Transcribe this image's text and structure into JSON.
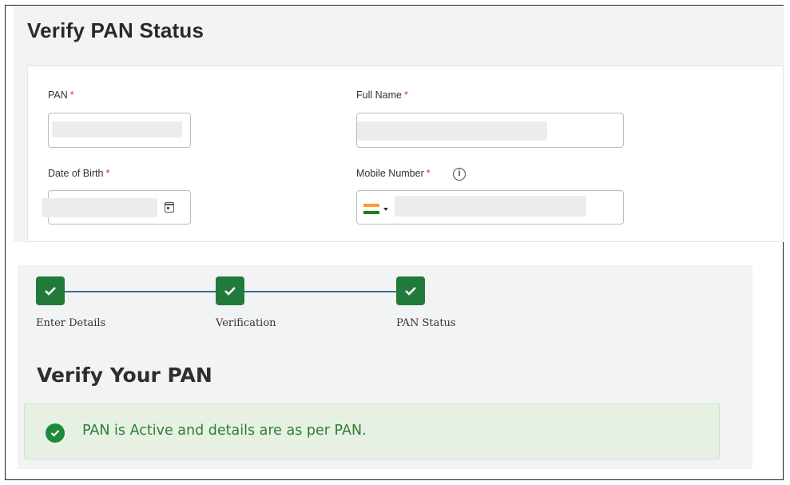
{
  "form": {
    "title": "Verify PAN Status",
    "pan_label": "PAN",
    "full_name_label": "Full Name",
    "dob_label": "Date of Birth",
    "mobile_label": "Mobile Number",
    "required_marker": "*",
    "info_icon_glyph": "i",
    "icons": [
      "calendar-icon",
      "info-icon",
      "india-flag-icon",
      "chevron-down-icon"
    ]
  },
  "steps": [
    {
      "label": "Enter Details",
      "completed": true
    },
    {
      "label": "Verification",
      "completed": true
    },
    {
      "label": "PAN Status",
      "completed": true
    }
  ],
  "result": {
    "title": "Verify Your PAN",
    "status_text": "PAN is Active and details are as per PAN.",
    "status_icon": "check-circle-icon"
  },
  "colors": {
    "step_green": "#227a3a",
    "step_line": "#3c6e8c",
    "required_red": "#d32f2f",
    "success_bg": "#e6f1e4",
    "success_text": "#2e7d32"
  }
}
